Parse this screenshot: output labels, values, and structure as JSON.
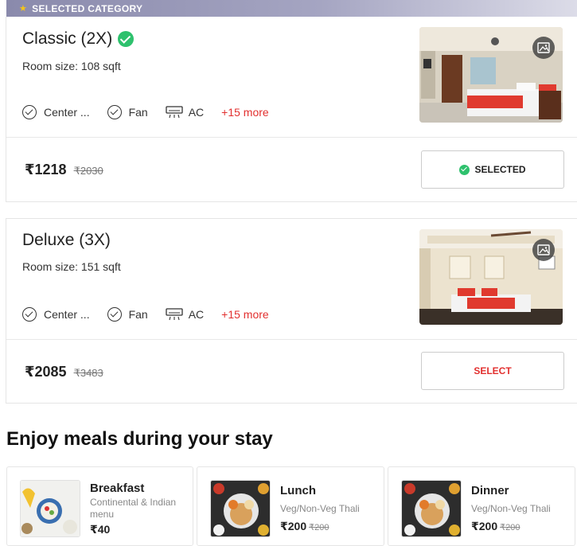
{
  "banner": {
    "label": "SELECTED CATEGORY",
    "star_icon": "star-icon"
  },
  "rooms": [
    {
      "name": "Classic (2X)",
      "size": "Room size: 108 sqft",
      "amenities": [
        "Center ...",
        "Fan",
        "AC"
      ],
      "more": "+15 more",
      "price": "₹1218",
      "original_price": "₹2030",
      "button": "SELECTED",
      "state": "selected"
    },
    {
      "name": "Deluxe (3X)",
      "size": "Room size: 151 sqft",
      "amenities": [
        "Center ...",
        "Fan",
        "AC"
      ],
      "more": "+15 more",
      "price": "₹2085",
      "original_price": "₹3483",
      "button": "SELECT",
      "state": "unselected"
    }
  ],
  "meals": {
    "heading": "Enjoy meals during your stay",
    "items": [
      {
        "name": "Breakfast",
        "description": "Continental & Indian menu",
        "price": "₹40",
        "original_price": ""
      },
      {
        "name": "Lunch",
        "description": "Veg/Non-Veg Thali",
        "price": "₹200",
        "original_price": "₹200"
      },
      {
        "name": "Dinner",
        "description": "Veg/Non-Veg Thali",
        "price": "₹200",
        "original_price": "₹200"
      }
    ]
  },
  "colors": {
    "accent_red": "#e2302f",
    "success_green": "#2ec16d",
    "banner_purple": "#8a8aac"
  }
}
